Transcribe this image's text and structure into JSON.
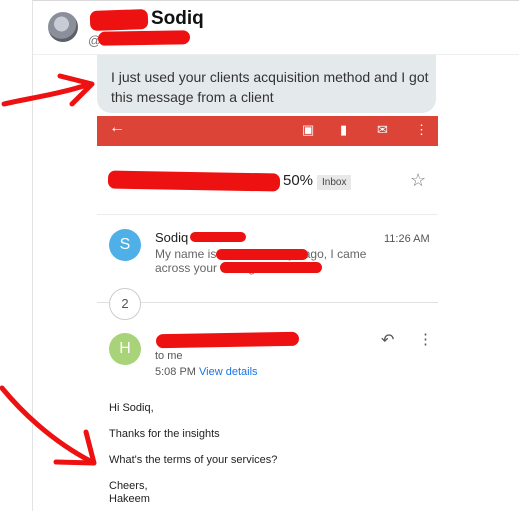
{
  "post": {
    "sender_name": "Sodiq",
    "sender_handle": "@",
    "message": "I just used your clients acquisition method and I got this message from a client"
  },
  "email": {
    "subject_suffix": "50%",
    "label_badge": "Inbox",
    "first_message": {
      "avatar_letter": "S",
      "sender": "Sodiq",
      "time": "11:26 AM",
      "snippet_line1": "My name is                and a few days ago, I came",
      "snippet_line2": "across your                                talking about"
    },
    "collapsed_count": "2",
    "second_message": {
      "avatar_letter": "H",
      "to": "to me",
      "time": "5:08 PM",
      "view_details": "View details",
      "body": [
        "Hi Sodiq,",
        "Thanks for the insights",
        "What's the terms of your services?",
        "Cheers,",
        "Hakeem"
      ]
    }
  },
  "colors": {
    "gmail_red": "#db4437",
    "redaction": "#ee1111",
    "link_blue": "#1a73e8"
  },
  "icons": [
    "back-arrow-icon",
    "archive-icon",
    "delete-icon",
    "mail-icon",
    "more-vert-icon",
    "star-icon",
    "reply-icon"
  ]
}
